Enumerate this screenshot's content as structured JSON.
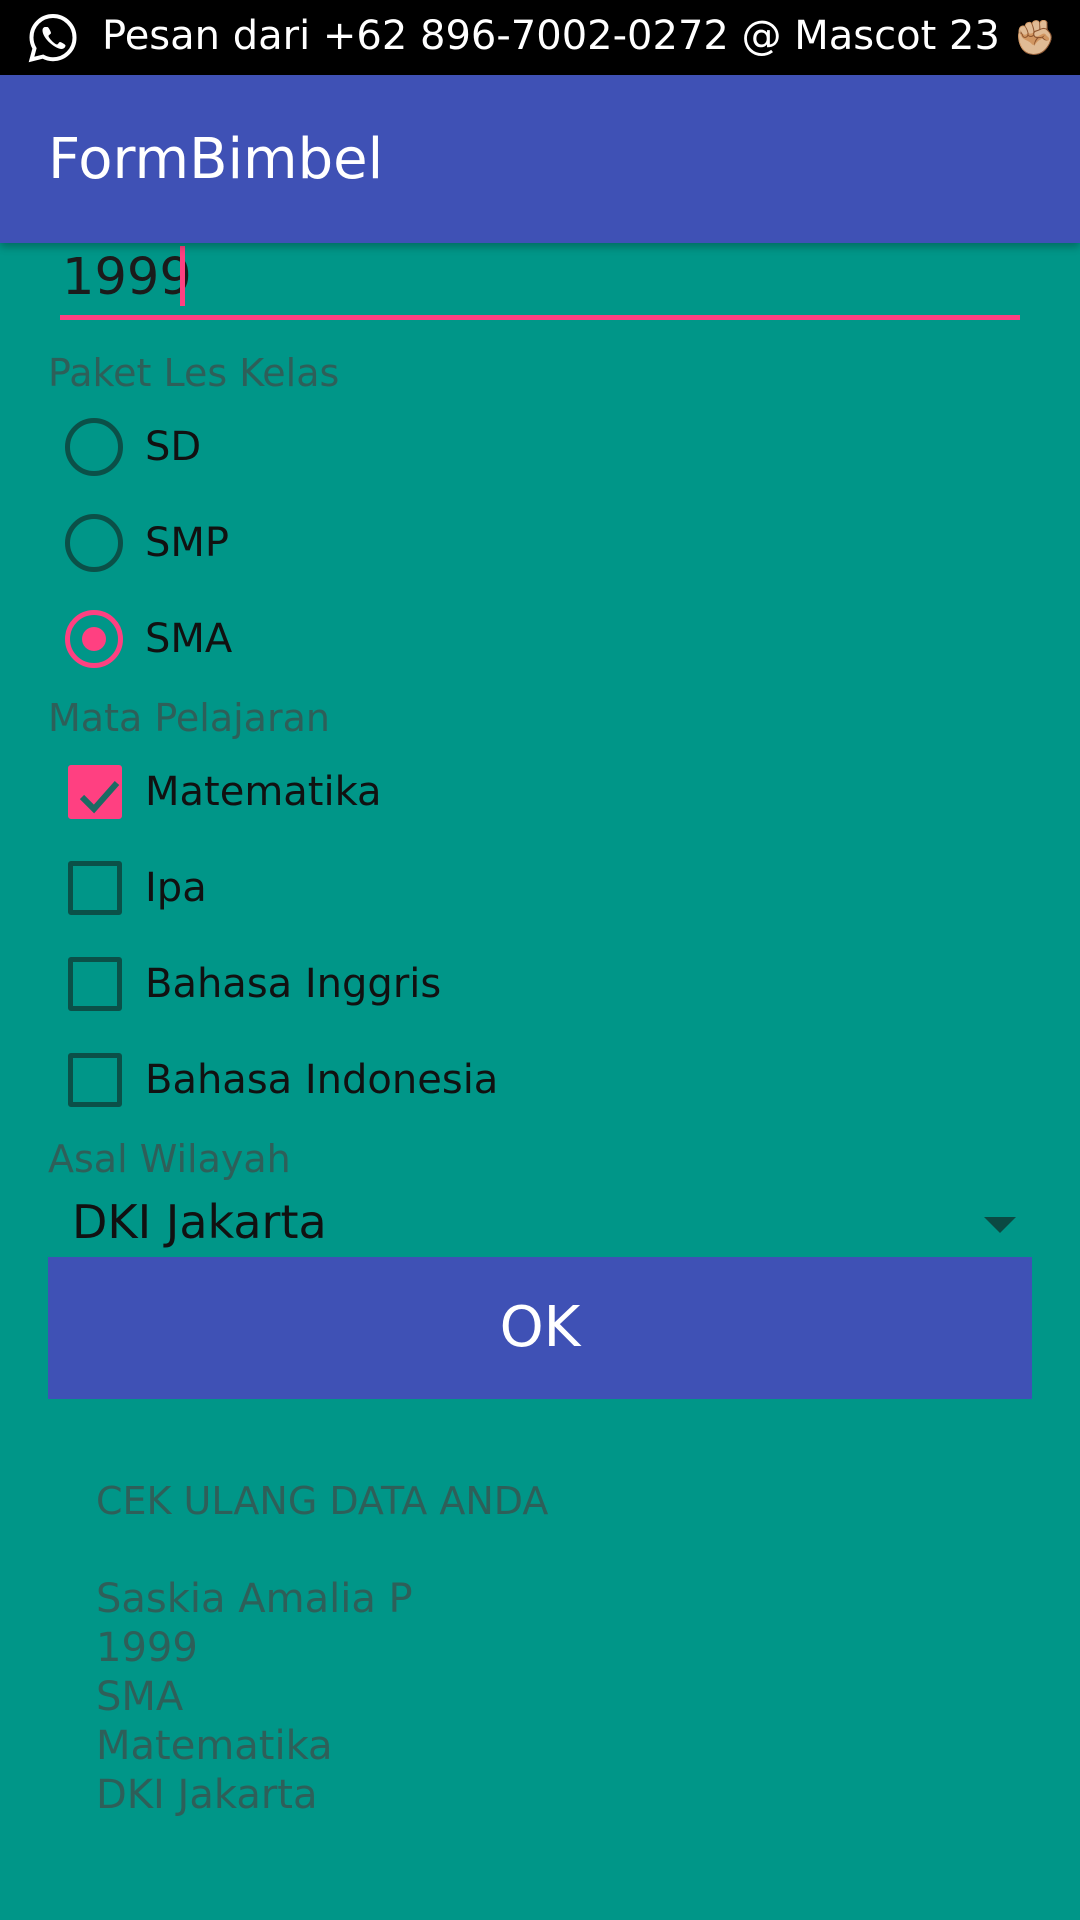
{
  "status_bar": {
    "notification_text": "Pesan dari +62 896-7002-0272 @ Mascot 23",
    "emoji": "✊🏼",
    "app_icon": "whatsapp-icon"
  },
  "app_bar": {
    "title": "FormBimbel"
  },
  "form": {
    "year_input": {
      "value": "1999"
    },
    "paket_label": "Paket Les Kelas",
    "paket_options": [
      {
        "label": "SD",
        "checked": false
      },
      {
        "label": "SMP",
        "checked": false
      },
      {
        "label": "SMA",
        "checked": true
      }
    ],
    "mapel_label": "Mata Pelajaran",
    "mapel_options": [
      {
        "label": "Matematika",
        "checked": true
      },
      {
        "label": "Ipa",
        "checked": false
      },
      {
        "label": "Bahasa Inggris",
        "checked": false
      },
      {
        "label": "Bahasa Indonesia",
        "checked": false
      }
    ],
    "wilayah_label": "Asal Wilayah",
    "wilayah_selected": "DKI Jakarta",
    "ok_label": "OK"
  },
  "summary": {
    "title": "CEK ULANG DATA ANDA",
    "lines": [
      "Saskia Amalia P",
      "1999",
      "SMA",
      "Matematika",
      "DKI Jakarta"
    ]
  },
  "colors": {
    "background": "#009688",
    "primary": "#3F51B5",
    "accent": "#FF4081"
  }
}
